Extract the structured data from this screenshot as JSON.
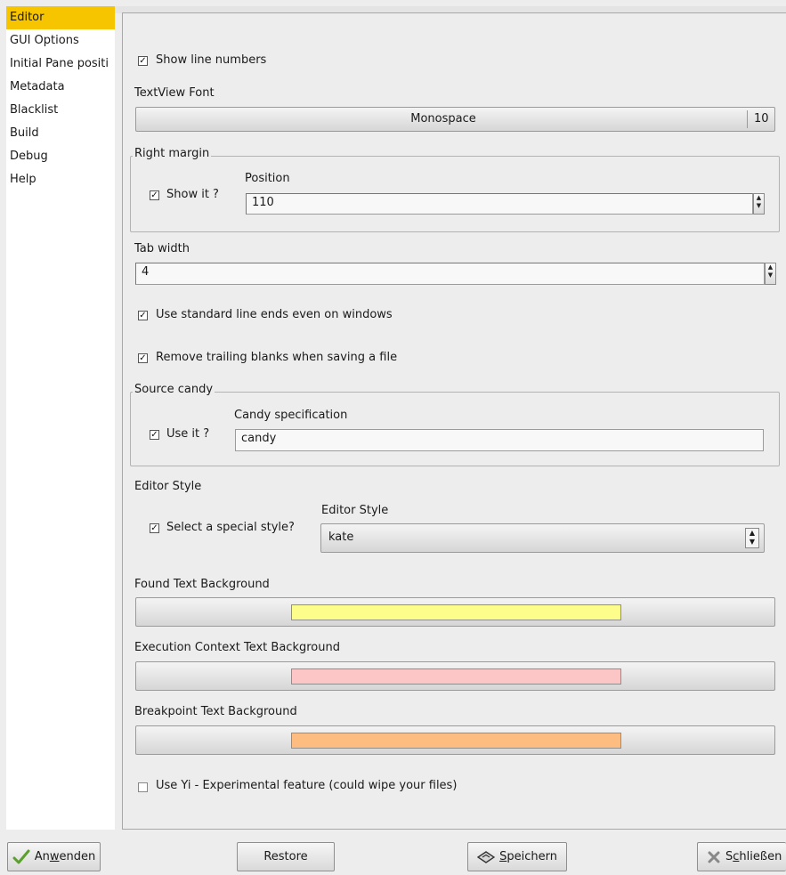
{
  "sidebar": {
    "items": [
      {
        "label": "Editor"
      },
      {
        "label": "GUI Options"
      },
      {
        "label": "Initial Pane positi"
      },
      {
        "label": "Metadata"
      },
      {
        "label": "Blacklist"
      },
      {
        "label": "Build"
      },
      {
        "label": "Debug"
      },
      {
        "label": "Help"
      }
    ],
    "selected_color": "#f6c500"
  },
  "editor": {
    "show_line_numbers": {
      "label": "Show line numbers",
      "checked": true
    },
    "textview_font": {
      "label": "TextView Font",
      "font_name": "Monospace",
      "font_size": "10"
    },
    "right_margin": {
      "title": "Right margin",
      "show_it": {
        "label": "Show it ?",
        "checked": true
      },
      "position_label": "Position",
      "position_value": "110"
    },
    "tab_width": {
      "label": "Tab width",
      "value": "4"
    },
    "standard_line_ends": {
      "label": "Use standard line ends even on windows",
      "checked": true
    },
    "remove_trailing": {
      "label": "Remove trailing blanks when saving a file",
      "checked": true
    },
    "source_candy": {
      "title": "Source candy",
      "use_it": {
        "label": "Use it ?",
        "checked": true
      },
      "spec_label": "Candy specification",
      "spec_value": "candy"
    },
    "editor_style": {
      "title": "Editor Style",
      "select_special": {
        "label": "Select a special style?",
        "checked": true
      },
      "style_label": "Editor Style",
      "style_value": "kate"
    },
    "found_bg": {
      "label": "Found Text Background",
      "color": "#fdfd8b"
    },
    "exec_bg": {
      "label": "Execution Context Text Background",
      "color": "#fdc6c6"
    },
    "breakpoint_bg": {
      "label": "Breakpoint Text Background",
      "color": "#fdbc80"
    },
    "use_yi": {
      "label": "Use Yi - Experimental feature (could wipe your files)",
      "checked": false
    }
  },
  "buttons": {
    "apply": {
      "label_pre": "An",
      "label_mnemonic": "w",
      "label_post": "enden",
      "icon": "checkmark-icon"
    },
    "restore": {
      "label": "Restore"
    },
    "save": {
      "label_pre": "",
      "label_mnemonic": "S",
      "label_post": "peichern",
      "icon": "save-icon"
    },
    "close": {
      "label_pre": "S",
      "label_mnemonic": "c",
      "label_post": "hließen",
      "icon": "close-icon"
    }
  }
}
